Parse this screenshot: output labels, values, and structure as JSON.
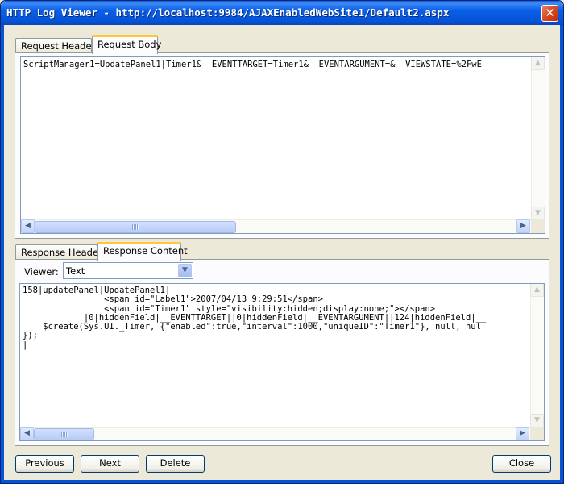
{
  "window": {
    "title": "HTTP Log Viewer - http://localhost:9984/AJAXEnabledWebSite1/Default2.aspx",
    "close_glyph": "✕"
  },
  "request": {
    "tabs": [
      {
        "label": "Request Headers",
        "active": false
      },
      {
        "label": "Request Body",
        "active": true
      }
    ],
    "body_text": "ScriptManager1=UpdatePanel1|Timer1&__EVENTTARGET=Timer1&__EVENTARGUMENT=&__VIEWSTATE=%2FwE"
  },
  "response": {
    "tabs": [
      {
        "label": "Response Headers",
        "active": false
      },
      {
        "label": "Response Content",
        "active": true
      }
    ],
    "viewer_label": "Viewer:",
    "viewer_selected": "Text",
    "content_lines": [
      "158|updatePanel|UpdatePanel1|",
      "                <span id=\"Label1\">2007/04/13 9:29:51</span>",
      "                <span id=\"Timer1\" style=\"visibility:hidden;display:none;\"></span>",
      "            |0|hiddenField|__EVENTTARGET||0|hiddenField|__EVENTARGUMENT||124|hiddenField|__",
      "    $create(Sys.UI._Timer, {\"enabled\":true,\"interval\":1000,\"uniqueID\":\"Timer1\"}, null, nul",
      "});",
      "|"
    ]
  },
  "buttons": {
    "previous": "Previous",
    "next": "Next",
    "delete": "Delete",
    "close": "Close"
  },
  "icons": {
    "scroll_up": "▲",
    "scroll_down": "▼",
    "scroll_left": "◀",
    "scroll_right": "▶",
    "dropdown": "▼"
  }
}
